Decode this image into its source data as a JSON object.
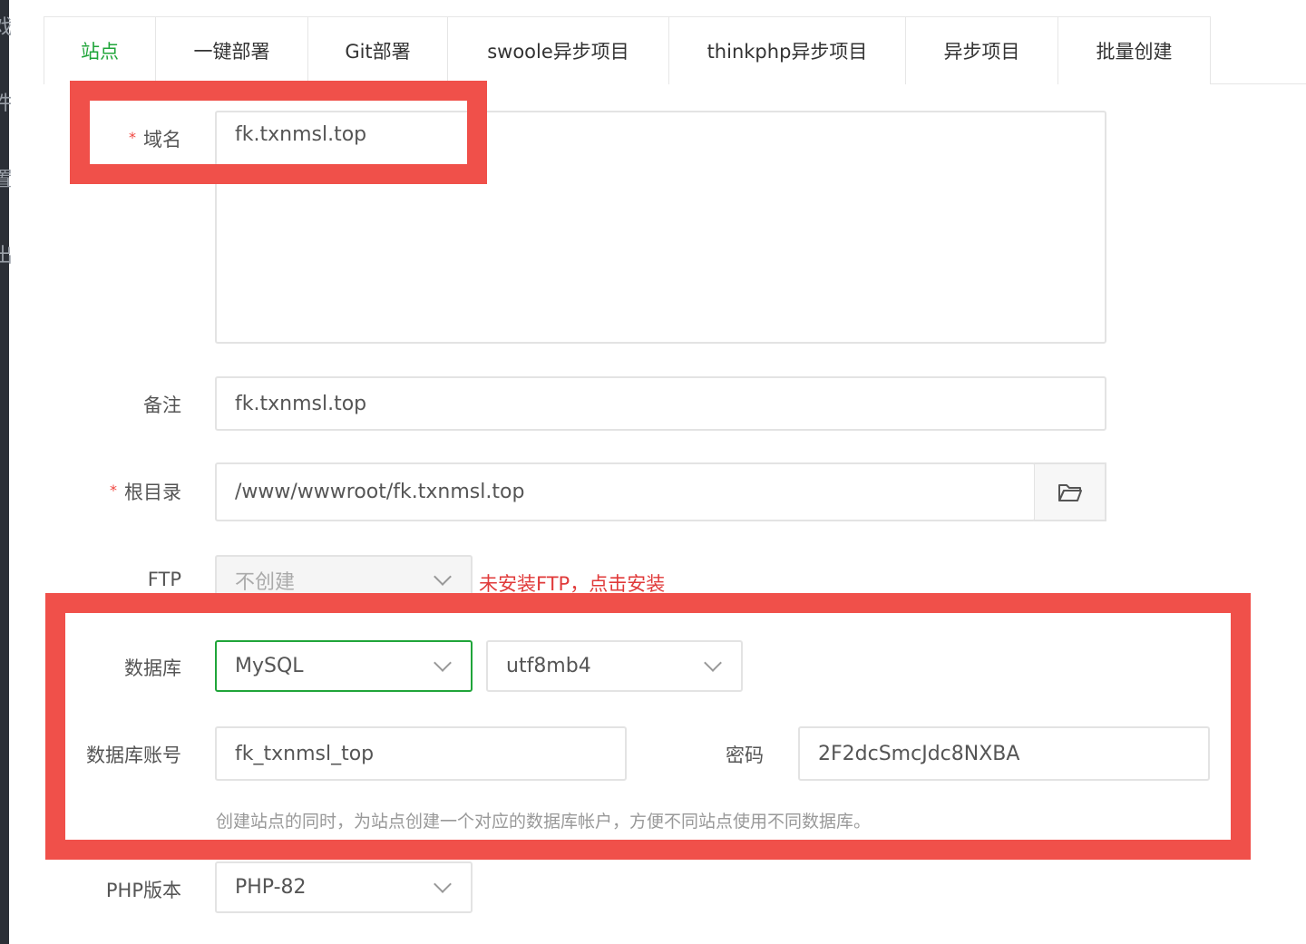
{
  "tabs": [
    {
      "label": "站点",
      "active": true
    },
    {
      "label": "一键部署"
    },
    {
      "label": "Git部署"
    },
    {
      "label": "swoole异步项目"
    },
    {
      "label": "thinkphp异步项目"
    },
    {
      "label": "异步项目"
    },
    {
      "label": "批量创建"
    }
  ],
  "left_strip": [
    "戏",
    "件",
    "置",
    "出"
  ],
  "form": {
    "domain_label": "域名",
    "domain_value": "fk.txnmsl.top",
    "remark_label": "备注",
    "remark_value": "fk.txnmsl.top",
    "root_label": "根目录",
    "root_value": "/www/wwwroot/fk.txnmsl.top",
    "ftp_label": "FTP",
    "ftp_value": "不创建",
    "ftp_link": "未安装FTP，点击安装",
    "db_label": "数据库",
    "db_value": "MySQL",
    "charset_value": "utf8mb4",
    "db_user_label": "数据库账号",
    "db_user_value": "fk_txnmsl_top",
    "password_label": "密码",
    "password_value": "2F2dcSmcJdc8NXBA",
    "db_hint": "创建站点的同时，为站点创建一个对应的数据库帐户，方便不同站点使用不同数据库。",
    "php_label": "PHP版本",
    "php_value": "PHP-82"
  },
  "colors": {
    "accent": "#20a53a",
    "highlight": "#f0504a",
    "required": "#f0453f"
  }
}
